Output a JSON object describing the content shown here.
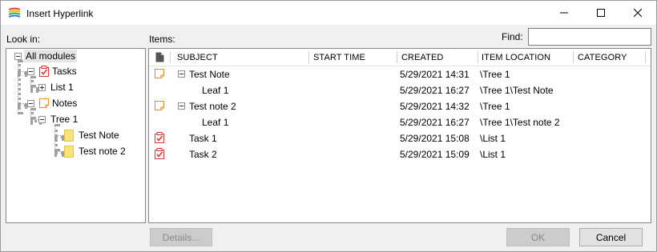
{
  "window": {
    "title": "Insert Hyperlink"
  },
  "labels": {
    "look_in": "Look in:",
    "items": "Items:",
    "find": "Find:"
  },
  "find": {
    "value": ""
  },
  "tree": {
    "root": "All modules",
    "tasks": "Tasks",
    "list1": "List 1",
    "notes": "Notes",
    "tree1": "Tree 1",
    "test_note": "Test Note",
    "test_note2": "Test note 2"
  },
  "columns": {
    "subject": "SUBJECT",
    "start_time": "START TIME",
    "created": "CREATED",
    "item_location": "ITEM LOCATION",
    "category": "CATEGORY"
  },
  "rows": [
    {
      "subject": "Test Note",
      "start": "",
      "created": "5/29/2021 14:31",
      "location": "\\Tree 1",
      "category": "",
      "icon": "note-icon"
    },
    {
      "subject": "Leaf 1",
      "start": "",
      "created": "5/29/2021 16:27",
      "location": "\\Tree 1\\Test Note",
      "category": ""
    },
    {
      "subject": "Test note 2",
      "start": "",
      "created": "5/29/2021 14:32",
      "location": "\\Tree 1",
      "category": "",
      "icon": "note-icon"
    },
    {
      "subject": "Leaf 1",
      "start": "",
      "created": "5/29/2021 16:27",
      "location": "\\Tree 1\\Test note 2",
      "category": ""
    },
    {
      "subject": "Task 1",
      "start": "",
      "created": "5/29/2021 15:08",
      "location": "\\List 1",
      "category": "",
      "icon": "task-icon"
    },
    {
      "subject": "Task 2",
      "start": "",
      "created": "5/29/2021 15:09",
      "location": "\\List 1",
      "category": "",
      "icon": "task-icon"
    }
  ],
  "buttons": {
    "details": "Details...",
    "ok": "OK",
    "cancel": "Cancel"
  },
  "colors": {
    "note_accent": "#f08a24",
    "task_accent": "#d93a2b",
    "folder_yellow": "#fbe37a"
  }
}
